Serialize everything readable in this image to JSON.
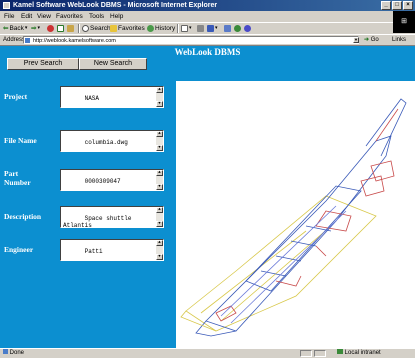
{
  "window": {
    "title": "Kamel Software WebLook DBMS - Microsoft Internet Explorer",
    "controls": [
      "_",
      "□",
      "×"
    ]
  },
  "menu": [
    "File",
    "Edit",
    "View",
    "Favorites",
    "Tools",
    "Help"
  ],
  "toolbar": {
    "back": "Back",
    "search": "Search",
    "favorites": "Favorites",
    "history": "History"
  },
  "address": {
    "label": "Address",
    "url": "http://weblook.kamelsoftware.com",
    "go": "Go",
    "links": "Links"
  },
  "page": {
    "title": "WebLook DBMS",
    "buttons": {
      "prev_search": "Prev Search",
      "new_search": "New Search"
    },
    "fields": [
      {
        "label": "Project",
        "value": "NASA"
      },
      {
        "label": "File Name",
        "value": "columbia.dwg"
      },
      {
        "label": "Part Number",
        "value": "0000309047"
      },
      {
        "label": "Description",
        "value": "Space shuttle\nAtlantis"
      },
      {
        "label": "Engineer",
        "value": "Patti"
      }
    ]
  },
  "status": {
    "left": "Done",
    "zone": "Local intranet"
  },
  "colors": {
    "page_blue": "#0c8fd0",
    "title_bar": "#0a246a",
    "chrome": "#d4d0c8"
  }
}
